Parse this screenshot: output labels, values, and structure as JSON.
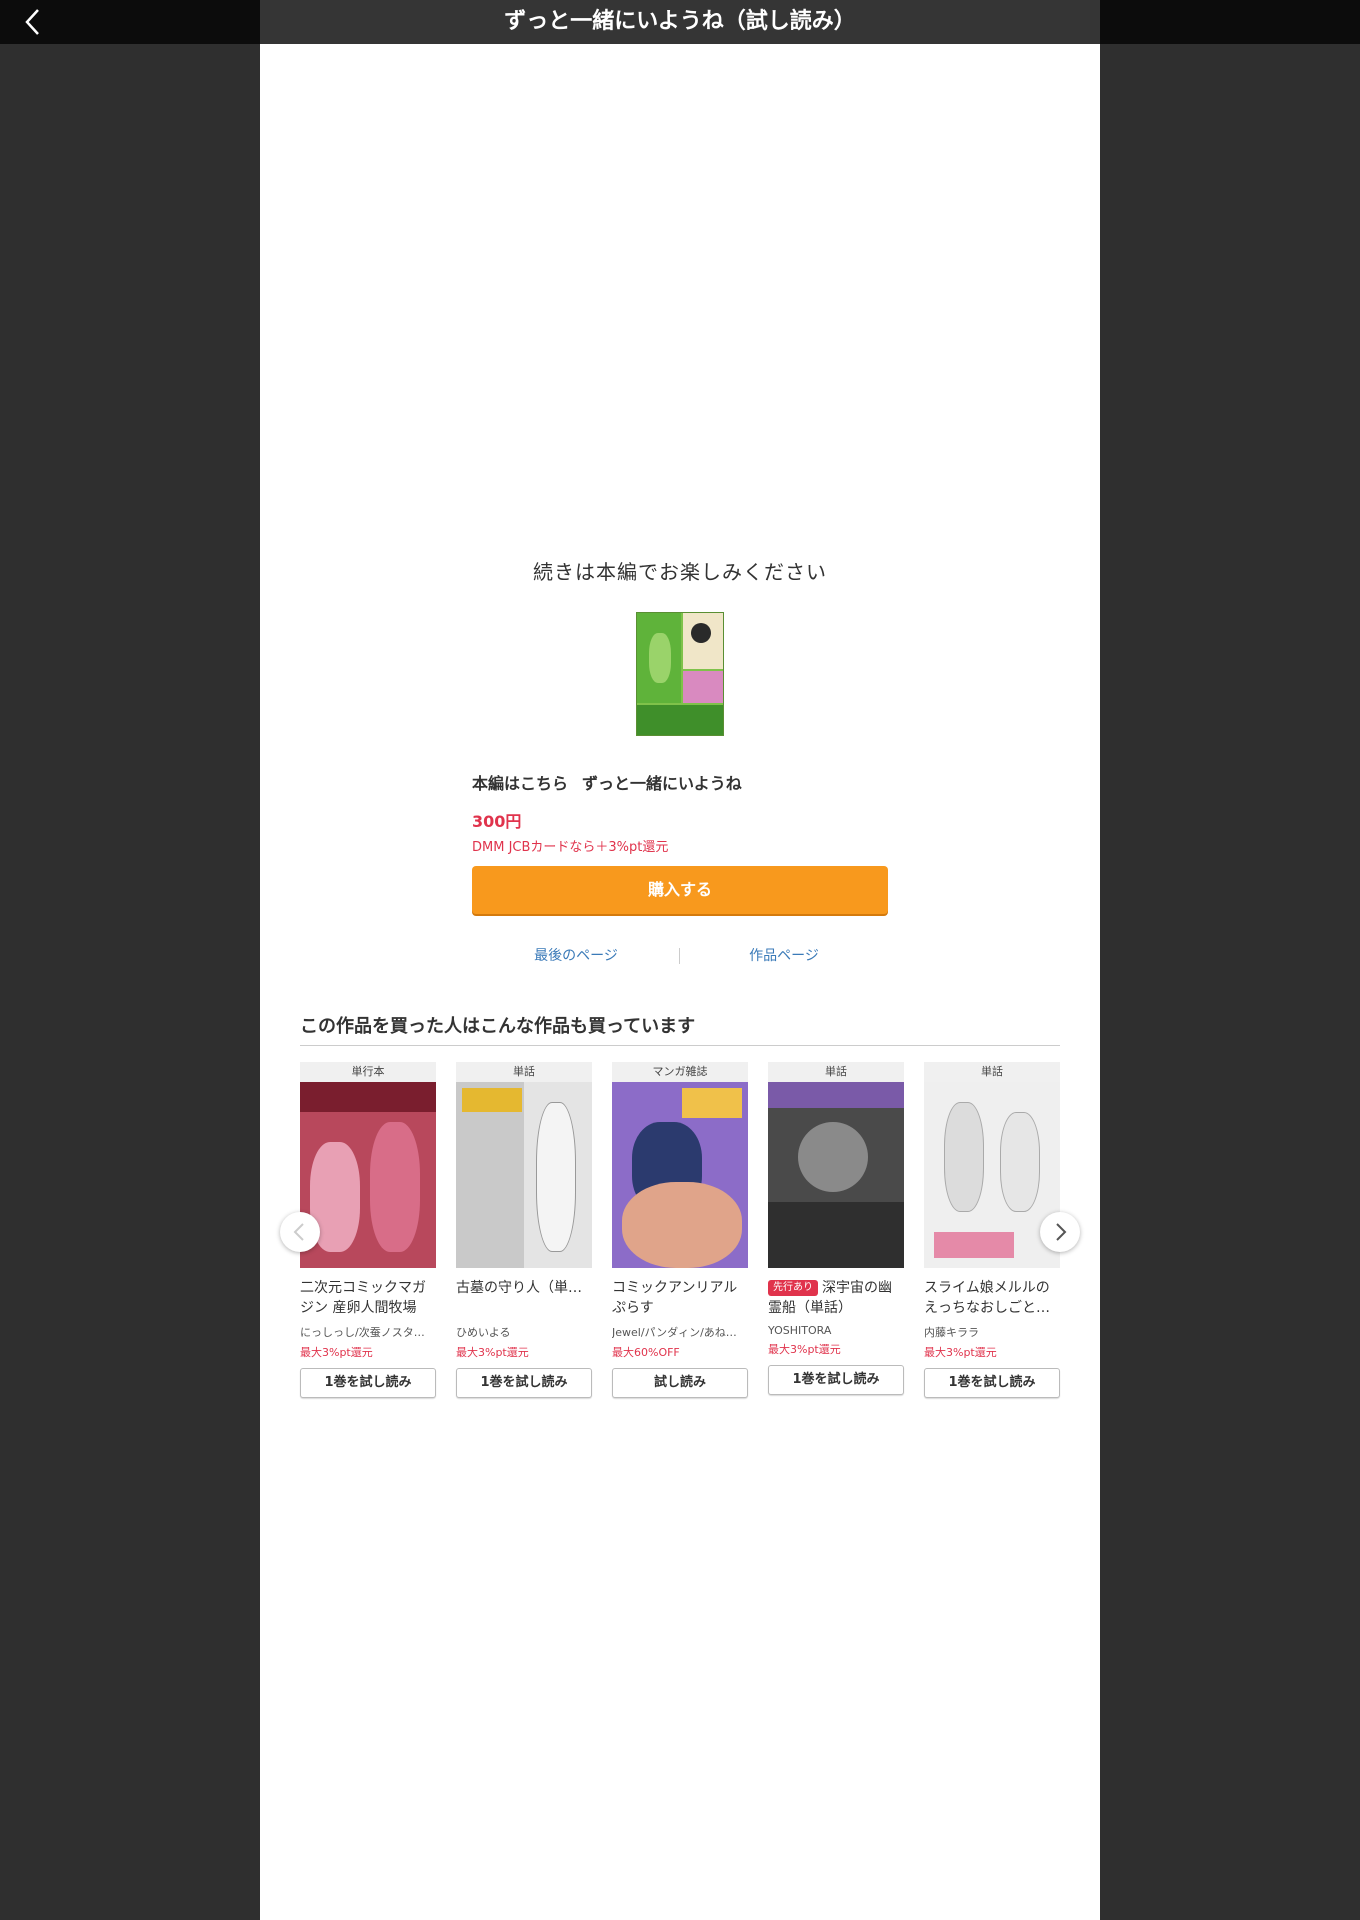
{
  "header": {
    "title": "ずっと一緒にいようね（試し読み）"
  },
  "viewer": {
    "continue_message": "続きは本編でお楽しみください"
  },
  "purchase": {
    "prefix": "本編はこちら",
    "work_title": "ずっと一緒にいようね",
    "price": "300円",
    "promo": "DMM JCBカードなら＋3%pt還元",
    "buy_label": "購入する",
    "last_page_label": "最後のページ",
    "work_page_label": "作品ページ"
  },
  "recommend": {
    "heading": "この作品を買った人はこんな作品も買っています",
    "items": [
      {
        "type": "単行本",
        "title": "二次元コミックマガジン 産卵人間牧場",
        "tag": "",
        "author": "にっしっし/次蚕ノスタ…",
        "pt": "最大3%pt還元",
        "button": "1巻を試し読み",
        "color": "#b8485c"
      },
      {
        "type": "単話",
        "title": "古墓の守り人（単…",
        "tag": "",
        "author": "ひめいよる",
        "pt": "最大3%pt還元",
        "button": "1巻を試し読み",
        "color": "#c9c9c9"
      },
      {
        "type": "マンガ雑誌",
        "title": "コミックアンリアル ぷらす",
        "tag": "",
        "author": "Jewel/パンダィン/あね…",
        "pt": "最大60%OFF",
        "button": "試し読み",
        "color": "#d88a6a"
      },
      {
        "type": "単話",
        "title": "深宇宙の幽霊船（単話）",
        "tag": "先行あり",
        "author": "YOSHITORA",
        "pt": "最大3%pt還元",
        "button": "1巻を試し読み",
        "color": "#4a4a4a"
      },
      {
        "type": "単話",
        "title": "スライム娘メルルのえっちなおしごと…",
        "tag": "",
        "author": "内藤キララ",
        "pt": "最大3%pt還元",
        "button": "1巻を試し読み",
        "color": "#dcdcdc"
      }
    ]
  },
  "icons": {
    "back": "chevron-left-icon",
    "prev": "chevron-left-icon",
    "next": "chevron-right-icon"
  },
  "colors": {
    "accent": "#f8991d",
    "price": "#e0334c",
    "link": "#3a7ab8"
  }
}
